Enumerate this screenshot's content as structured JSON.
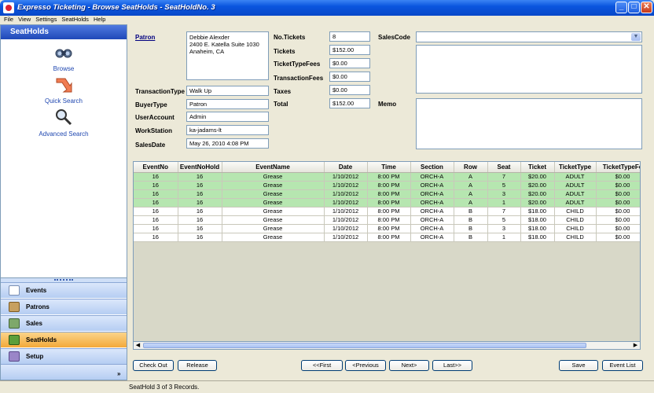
{
  "window": {
    "title": "Expresso Ticketing - Browse SeatHolds - SeatHoldNo. 3",
    "min": "_",
    "max": "□",
    "close": "✕"
  },
  "menu": [
    "File",
    "View",
    "Settings",
    "SeatHolds",
    "Help"
  ],
  "sidebar": {
    "header": "SeatHolds",
    "links": [
      "Browse",
      "Quick Search",
      "Advanced Search"
    ],
    "nav": [
      "Events",
      "Patrons",
      "Sales",
      "SeatHolds",
      "Setup"
    ],
    "active": "SeatHolds",
    "more": "»"
  },
  "form": {
    "patron_label": "Patron",
    "patron_lines": [
      "Debbie Alexder",
      "2400 E. Katella Suite 1030",
      "Anaheim, CA"
    ],
    "transaction_type_label": "TransactionType",
    "transaction_type": "Walk Up",
    "buyer_type_label": "BuyerType",
    "buyer_type": "Patron",
    "user_account_label": "UserAccount",
    "user_account": "Admin",
    "workstation_label": "WorkStation",
    "workstation": "ka-jadams-lt",
    "sales_date_label": "SalesDate",
    "sales_date": "May 26, 2010  4:08  PM",
    "no_tickets_label": "No.Tickets",
    "no_tickets": "8",
    "tickets_label": "Tickets",
    "tickets": "$152.00",
    "ticket_type_fees_label": "TicketTypeFees",
    "ticket_type_fees": "$0.00",
    "transaction_fees_label": "TransactionFees",
    "transaction_fees": "$0.00",
    "taxes_label": "Taxes",
    "taxes": "$0.00",
    "total_label": "Total",
    "total": "$152.00",
    "sales_code_label": "SalesCode",
    "sales_code": "",
    "memo_label": "Memo"
  },
  "grid": {
    "columns": [
      "EventNo",
      "EventNoHold",
      "EventName",
      "Date",
      "Time",
      "Section",
      "Row",
      "Seat",
      "Ticket",
      "TicketType",
      "TicketTypeFe"
    ],
    "rows": [
      [
        "16",
        "16",
        "Grease",
        "1/10/2012",
        "8:00 PM",
        "ORCH-A",
        "A",
        "7",
        "$20.00",
        "ADULT",
        "$0.00"
      ],
      [
        "16",
        "16",
        "Grease",
        "1/10/2012",
        "8:00 PM",
        "ORCH-A",
        "A",
        "5",
        "$20.00",
        "ADULT",
        "$0.00"
      ],
      [
        "16",
        "16",
        "Grease",
        "1/10/2012",
        "8:00 PM",
        "ORCH-A",
        "A",
        "3",
        "$20.00",
        "ADULT",
        "$0.00"
      ],
      [
        "16",
        "16",
        "Grease",
        "1/10/2012",
        "8:00 PM",
        "ORCH-A",
        "A",
        "1",
        "$20.00",
        "ADULT",
        "$0.00"
      ],
      [
        "16",
        "16",
        "Grease",
        "1/10/2012",
        "8:00 PM",
        "ORCH-A",
        "B",
        "7",
        "$18.00",
        "CHILD",
        "$0.00"
      ],
      [
        "16",
        "16",
        "Grease",
        "1/10/2012",
        "8:00 PM",
        "ORCH-A",
        "B",
        "5",
        "$18.00",
        "CHILD",
        "$0.00"
      ],
      [
        "16",
        "16",
        "Grease",
        "1/10/2012",
        "8:00 PM",
        "ORCH-A",
        "B",
        "3",
        "$18.00",
        "CHILD",
        "$0.00"
      ],
      [
        "16",
        "16",
        "Grease",
        "1/10/2012",
        "8:00 PM",
        "ORCH-A",
        "B",
        "1",
        "$18.00",
        "CHILD",
        "$0.00"
      ]
    ],
    "selected_rows": 4
  },
  "buttons": {
    "check_out": "Check Out",
    "release": "Release",
    "first": "<<First",
    "previous": "<Previous",
    "next": "Next>",
    "last": "Last>>",
    "save": "Save",
    "event_list": "Event List"
  },
  "status": "SeatHold 3 of 3 Records.",
  "colors": {
    "selected_row": "#b6e6b0",
    "active_nav": "#f3a93a",
    "title_bar": "#0a55df"
  }
}
